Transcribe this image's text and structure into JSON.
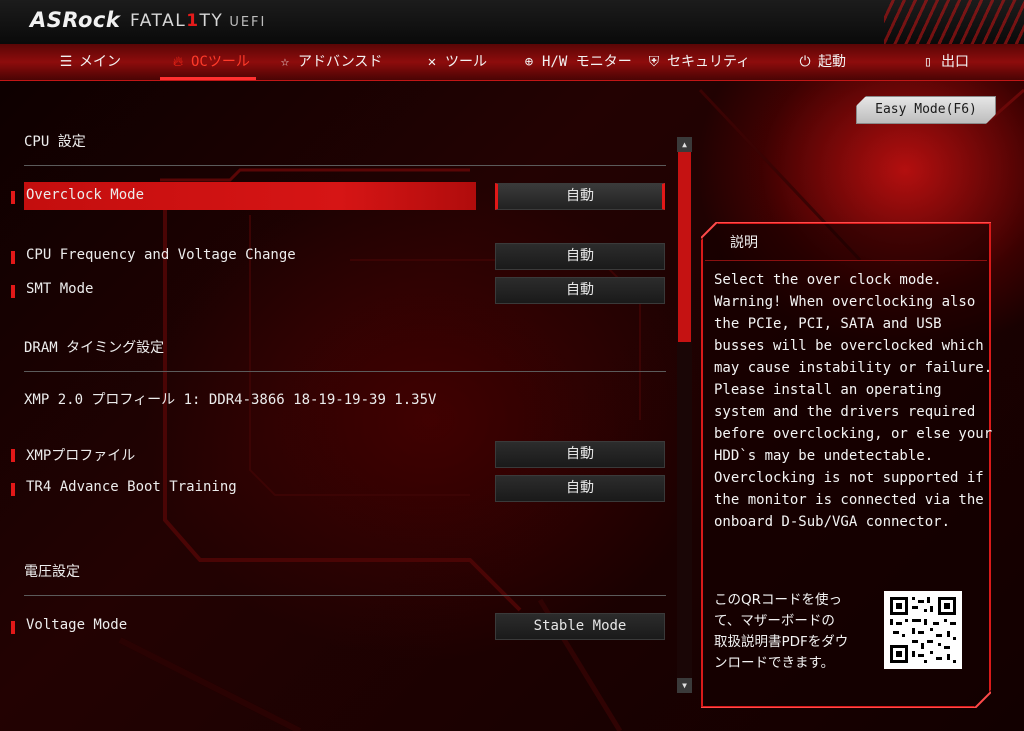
{
  "header": {
    "brand": "ASRock",
    "product_pre": "FATAL",
    "product_one": "1",
    "product_post": "TY",
    "firmware": "UEFI"
  },
  "nav": [
    {
      "label": "メイン",
      "icon": "list-icon"
    },
    {
      "label": "OCツール",
      "icon": "flame-icon"
    },
    {
      "label": "アドバンスド",
      "icon": "star-icon"
    },
    {
      "label": "ツール",
      "icon": "tools-icon"
    },
    {
      "label": "H/W モニター",
      "icon": "crosshair-icon"
    },
    {
      "label": "セキュリティ",
      "icon": "shield-icon"
    },
    {
      "label": "起動",
      "icon": "power-icon"
    },
    {
      "label": "出口",
      "icon": "exit-door-icon"
    }
  ],
  "active_nav": "OCツール",
  "easy_mode": "Easy Mode(F6)",
  "settings": {
    "cpu_section": "CPU 設定",
    "overclock_mode": {
      "label": "Overclock Mode",
      "value": "自動"
    },
    "cpu_freq": {
      "label": "CPU Frequency and Voltage Change",
      "value": "自動"
    },
    "smt_mode": {
      "label": "SMT Mode",
      "value": "自動"
    },
    "dram_section": "DRAM タイミング設定",
    "xmp_info": "XMP 2.0 プロフィール 1: DDR4-3866 18-19-19-39 1.35V",
    "xmp_profile": {
      "label": "XMPプロファイル",
      "value": "自動"
    },
    "tr4_training": {
      "label": "TR4 Advance Boot Training",
      "value": "自動"
    },
    "voltage_section": "電圧設定",
    "voltage_mode": {
      "label": "Voltage Mode",
      "value": "Stable Mode"
    }
  },
  "description": {
    "title": "説明",
    "lines": [
      "Select the over clock mode.",
      "Warning! When overclocking also",
      "the PCIe, PCI, SATA and USB",
      "busses will be overclocked which",
      "may cause instability or failure.",
      "Please install an operating",
      "system and the drivers required",
      "before overclocking, or else your",
      "HDD`s may be undetectable.",
      "Overclocking is not supported if",
      "the monitor is connected via the",
      "onboard D-Sub/VGA connector."
    ],
    "qr_lines": [
      "このQRコードを使っ",
      "て、マザーボードの",
      "取扱説明書PDFをダウ",
      "ンロードできます。"
    ]
  },
  "colors": {
    "accent": "#e21818",
    "highlight": "#c40e0e",
    "background": "#0b0000"
  }
}
